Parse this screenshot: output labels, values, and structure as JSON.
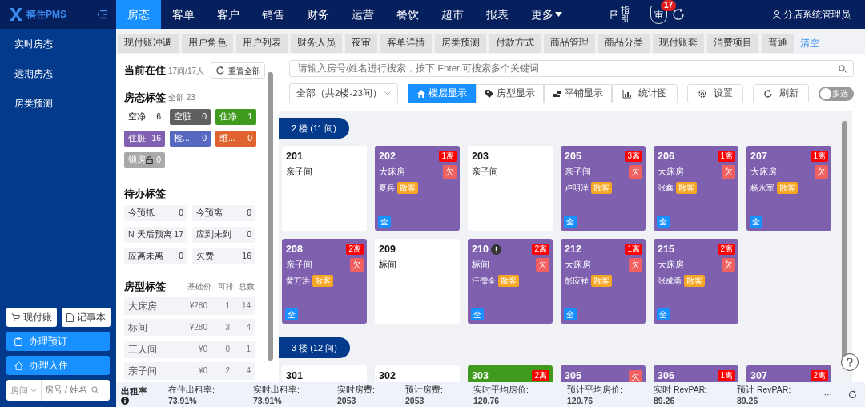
{
  "brand": {
    "name": "禧住PMS"
  },
  "nav": [
    {
      "label": "房态",
      "selected": true,
      "caret": false
    },
    {
      "label": "客单",
      "selected": false,
      "caret": false
    },
    {
      "label": "客户",
      "selected": false,
      "caret": false
    },
    {
      "label": "销售",
      "selected": false,
      "caret": false
    },
    {
      "label": "财务",
      "selected": false,
      "caret": false
    },
    {
      "label": "运营",
      "selected": false,
      "caret": false
    },
    {
      "label": "餐饮",
      "selected": false,
      "caret": false
    },
    {
      "label": "超市",
      "selected": false,
      "caret": false
    },
    {
      "label": "报表",
      "selected": false,
      "caret": false
    },
    {
      "label": "更多",
      "selected": false,
      "caret": true
    }
  ],
  "header_tools": {
    "guide": "指引",
    "audit": "审",
    "audit_count": "17",
    "user": "分店系统管理员"
  },
  "sidebar": {
    "items": [
      "实时房态",
      "远期房态",
      "房类预测"
    ]
  },
  "sidebar_actions": {
    "cash_account": "现付账",
    "notebook": "记事本",
    "book": "办理预订",
    "check_in": "办理入住",
    "search_scope": "房间",
    "search_placeholder": "房号 / 姓名"
  },
  "open_tabs": {
    "items": [
      "现付账冲调",
      "用户角色",
      "用户列表",
      "财务人员",
      "夜审",
      "客单详情",
      "房类预测",
      "付款方式",
      "商品管理",
      "商品分类",
      "现付账套",
      "消费项目",
      "普通"
    ],
    "clear": "清空"
  },
  "panel": {
    "occupancy": {
      "title": "当前在住",
      "summary": "17间/17人",
      "reset": "重置全部"
    },
    "status_tags": {
      "title": "房态标签",
      "summary": "全部 23",
      "items": [
        {
          "label": "空净",
          "count": "6",
          "color": "#ffffff",
          "locked": false
        },
        {
          "label": "空脏",
          "count": "0",
          "color": "#5f5f5f",
          "locked": false
        },
        {
          "label": "住净",
          "count": "1",
          "color": "#3f9a1e",
          "locked": false
        },
        {
          "label": "住脏",
          "count": "16",
          "color": "#8060b0",
          "locked": false
        },
        {
          "label": "检...",
          "count": "0",
          "color": "#5668c0",
          "locked": false
        },
        {
          "label": "维...",
          "count": "0",
          "color": "#e0632f",
          "locked": false
        },
        {
          "label": "锁房",
          "count": "0",
          "color": "#a9a9a9",
          "locked": true
        }
      ]
    },
    "todo_tags": {
      "title": "待办标签",
      "items": [
        {
          "label": "今预抵",
          "count": "0"
        },
        {
          "label": "今预离",
          "count": "0"
        },
        {
          "label": "N 天后预离",
          "count": "17"
        },
        {
          "label": "应到未到",
          "count": "0"
        },
        {
          "label": "应离未离",
          "count": "0"
        },
        {
          "label": "欠费",
          "count": "16"
        }
      ]
    },
    "room_types": {
      "title": "房型标签",
      "columns": [
        "基础价",
        "可排",
        "总数"
      ],
      "rows": [
        {
          "name": "大床房",
          "price": "¥280",
          "available": "1",
          "total": "14"
        },
        {
          "name": "标间",
          "price": "¥280",
          "available": "3",
          "total": "4"
        },
        {
          "name": "三人间",
          "price": "¥0",
          "available": "0",
          "total": "1"
        },
        {
          "name": "亲子间",
          "price": "¥0",
          "available": "2",
          "total": "4"
        }
      ]
    }
  },
  "toolbar": {
    "search_placeholder": "请输入房号/姓名进行搜索，按下 Enter 可搜索多个关键词",
    "floor_filter": "全部（共2楼-23间）",
    "views": [
      {
        "label": "楼层显示",
        "selected": true
      },
      {
        "label": "房型显示",
        "selected": false
      },
      {
        "label": "平铺显示",
        "selected": false
      }
    ],
    "buttons": [
      {
        "label": "统计图"
      },
      {
        "label": "设置"
      },
      {
        "label": "刷新"
      }
    ],
    "multi_select": {
      "label": "多选",
      "on": false
    }
  },
  "floors": [
    {
      "label": "2 楼 (11 间)",
      "rooms": [
        {
          "number": "201",
          "kind": "vacant",
          "room_type": "亲子间"
        },
        {
          "number": "202",
          "kind": "occupied",
          "departure": "1离",
          "room_type": "大床房",
          "owing": "欠",
          "guest": "夏兵",
          "guest_tag": "散客",
          "badge": "全"
        },
        {
          "number": "203",
          "kind": "vacant",
          "room_type": "亲子间"
        },
        {
          "number": "205",
          "kind": "occupied",
          "departure": "3离",
          "room_type": "亲子间",
          "owing": "欠",
          "guest": "卢明洋",
          "guest_tag": "散客",
          "badge": "全"
        },
        {
          "number": "206",
          "kind": "occupied",
          "departure": "1离",
          "room_type": "大床房",
          "owing": "欠",
          "guest": "张鑫",
          "guest_tag": "散客",
          "badge": "全"
        },
        {
          "number": "207",
          "kind": "occupied",
          "departure": "1离",
          "room_type": "大床房",
          "owing": "欠",
          "guest": "杨永军",
          "guest_tag": "散客",
          "badge": "全"
        },
        {
          "number": "208",
          "kind": "occupied",
          "departure": "2离",
          "room_type": "亲子间",
          "owing": "欠",
          "guest": "黄万洪",
          "guest_tag": "散客",
          "badge": "全"
        },
        {
          "number": "209",
          "kind": "vacant",
          "room_type": "标间"
        },
        {
          "number": "210",
          "kind": "occupied",
          "alert": true,
          "departure": "2离",
          "room_type": "标间",
          "owing": "欠",
          "guest": "汪儒全",
          "guest_tag": "散客",
          "badge": "全"
        },
        {
          "number": "212",
          "kind": "occupied",
          "departure": "1离",
          "room_type": "大床房",
          "owing": "欠",
          "guest": "彭应祥",
          "guest_tag": "散客",
          "badge": "全"
        },
        {
          "number": "215",
          "kind": "occupied",
          "departure": "2离",
          "room_type": "大床房",
          "owing": "欠",
          "guest": "张成勇",
          "guest_tag": "散客",
          "badge": "全"
        }
      ]
    },
    {
      "label": "3 楼 (12 间)",
      "rooms": [
        {
          "number": "301",
          "kind": "vacant"
        },
        {
          "number": "302",
          "kind": "vacant"
        },
        {
          "number": "303",
          "kind": "occupied_clean",
          "departure": "2离"
        },
        {
          "number": "305",
          "kind": "occupied",
          "owing": "欠"
        },
        {
          "number": "306",
          "kind": "occupied",
          "departure": "1离"
        },
        {
          "number": "307",
          "kind": "occupied",
          "departure": "2离"
        }
      ]
    }
  ],
  "stats": {
    "title": "出租率",
    "items": [
      {
        "label": "在住出租率:",
        "value": "73.91%"
      },
      {
        "label": "实时出租率:",
        "value": "73.91%"
      },
      {
        "label": "实时房费:",
        "value": "2053"
      },
      {
        "label": "预计房费:",
        "value": "2053"
      },
      {
        "label": "实时平均房价:",
        "value": "120.76"
      },
      {
        "label": "预计平均房价:",
        "value": "120.76"
      },
      {
        "label": "实时 RevPAR:",
        "value": "89.26"
      },
      {
        "label": "预计 RevPAR:",
        "value": "89.26"
      }
    ],
    "more": "···"
  }
}
